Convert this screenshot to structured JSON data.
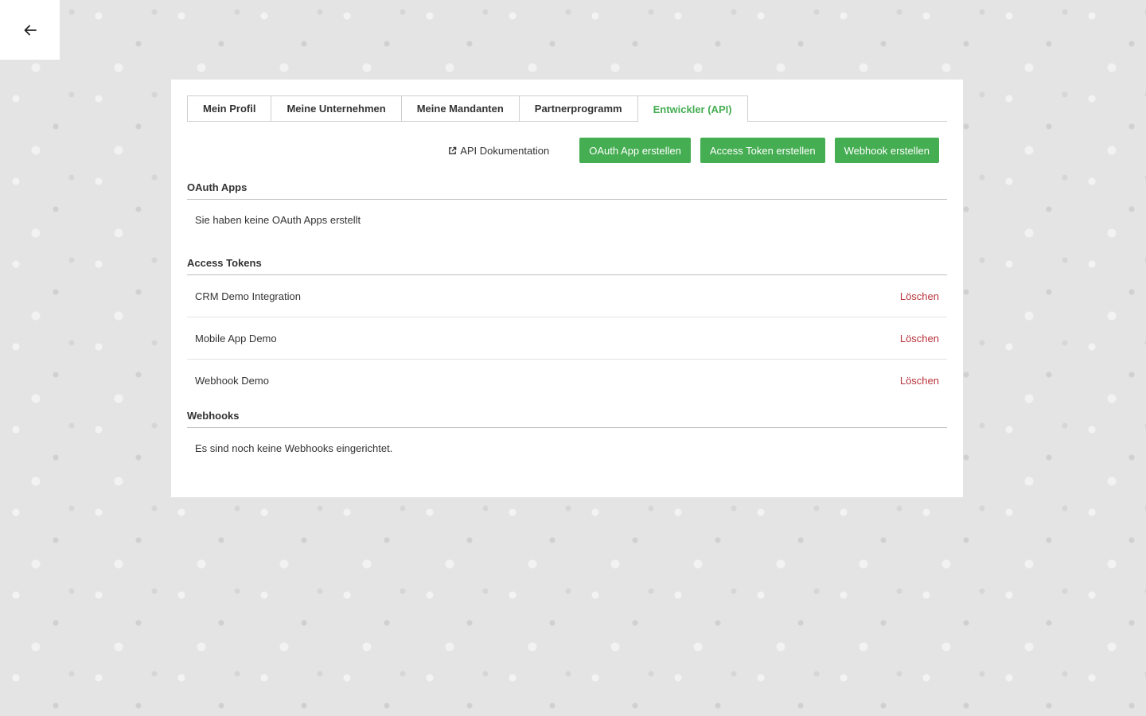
{
  "nav": {
    "back_icon": "arrow-left-icon"
  },
  "tabs": [
    {
      "label": "Mein Profil",
      "active": false
    },
    {
      "label": "Meine Unternehmen",
      "active": false
    },
    {
      "label": "Meine Mandanten",
      "active": false
    },
    {
      "label": "Partnerprogramm",
      "active": false
    },
    {
      "label": "Entwickler (API)",
      "active": true
    }
  ],
  "toolbar": {
    "doc_link_label": "API Dokumentation",
    "doc_link_icon": "external-link-icon",
    "create_oauth_label": "OAuth App erstellen",
    "create_token_label": "Access Token erstellen",
    "create_webhook_label": "Webhook erstellen"
  },
  "oauth": {
    "title": "OAuth Apps",
    "empty_text": "Sie haben keine OAuth Apps erstellt"
  },
  "tokens": {
    "title": "Access Tokens",
    "items": [
      {
        "name": "CRM Demo Integration",
        "action": "Löschen"
      },
      {
        "name": "Mobile App Demo",
        "action": "Löschen"
      },
      {
        "name": "Webhook Demo",
        "action": "Löschen"
      }
    ]
  },
  "webhooks": {
    "title": "Webhooks",
    "empty_text": "Es sind noch keine Webhooks eingerichtet."
  },
  "colors": {
    "accent": "#45ad52",
    "danger": "#b8333b",
    "background": "#e4e4e4"
  }
}
